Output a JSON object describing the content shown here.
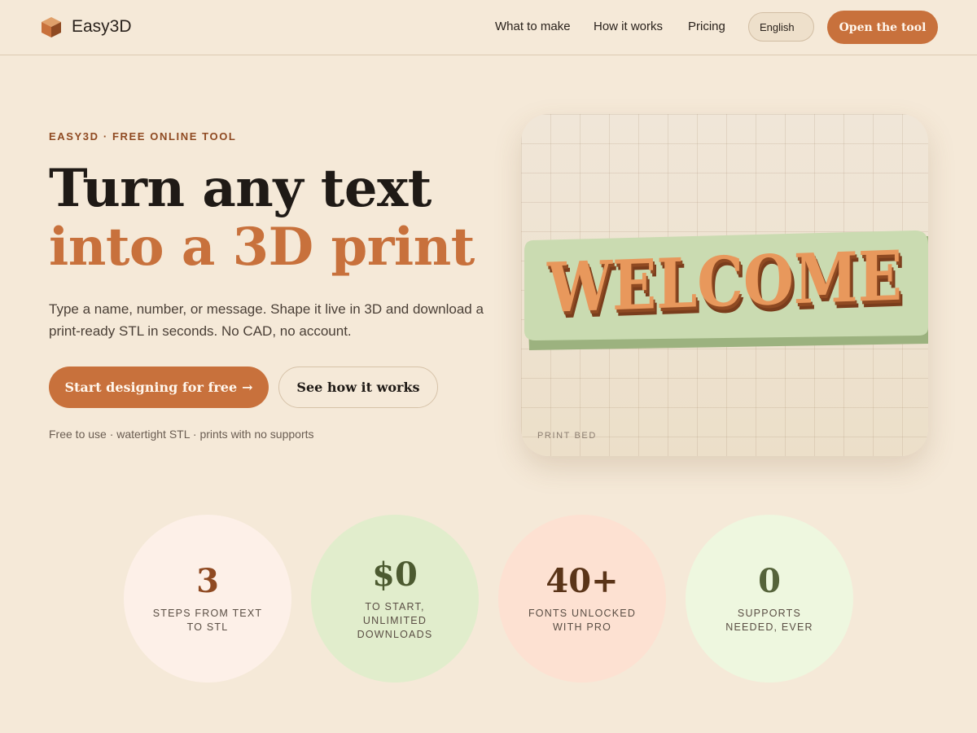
{
  "header": {
    "logo_text": "Easy3D",
    "nav": [
      "What to make",
      "How it works",
      "Pricing"
    ],
    "language": "English",
    "cta": "Open the tool"
  },
  "hero": {
    "eyebrow": "EASY3D · FREE ONLINE TOOL",
    "title_line1": "Turn any text",
    "title_line2": "into a 3D print",
    "subtitle": "Type a name, number, or message. Shape it live in 3D and download a print-ready STL in seconds. No CAD, no account.",
    "primary_cta": "Start designing for free",
    "primary_cta_icon": "arrow-right-icon",
    "secondary_cta": "See how it works",
    "fineprint": "Free to use · watertight STL · prints with no supports"
  },
  "preview": {
    "model_text": "WELCOME",
    "bed_label": "PRINT BED"
  },
  "stats": [
    {
      "value": "3",
      "label": "STEPS FROM TEXT TO STL",
      "color": "#8f4a22",
      "bg": "#fdf0e8"
    },
    {
      "value": "$0",
      "label": "TO START, UNLIMITED DOWNLOADS",
      "color": "#4c5a30",
      "bg": "#e1edcc"
    },
    {
      "value": "40+",
      "label": "FONTS UNLOCKED WITH PRO",
      "color": "#5a3418",
      "bg": "#fde1d2"
    },
    {
      "value": "0",
      "label": "SUPPORTS NEEDED, EVER",
      "color": "#55633a",
      "bg": "#eef7df"
    }
  ],
  "colors": {
    "background": "#f5e9d8",
    "accent": "#c8713c",
    "plate": "#cadbb1",
    "letters": "#e8985c"
  }
}
